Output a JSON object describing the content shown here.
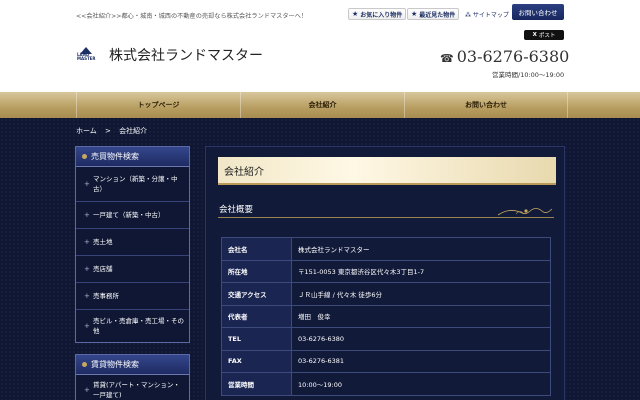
{
  "header": {
    "tagline": "<<会社紹介>>都心・城南・城西の不動産の売却なら株式会社ランドマスターへ！",
    "favorites_label": "お気に入り物件",
    "recent_label": "最近見た物件",
    "sitemap_label": "サイトマップ",
    "contact_label": "お問い合わせ",
    "x_post_label": "ポスト",
    "logo_text_1": "LAND",
    "logo_text_2": "MASTER",
    "company_name": "株式会社ランドマスター",
    "phone": "03-6276-6380",
    "hours": "営業時間/10:00～19:00"
  },
  "nav": {
    "items": [
      {
        "label": "トップページ"
      },
      {
        "label": "会社紹介"
      },
      {
        "label": "お問い合わせ"
      }
    ]
  },
  "breadcrumb": {
    "home": "ホーム",
    "separator": ">",
    "current": "会社紹介"
  },
  "sidebar": {
    "sale_title": "売買物件検索",
    "sale_items": [
      {
        "label": "マンション（新築・分譲・中古）"
      },
      {
        "label": "一戸建て（新築・中古）"
      },
      {
        "label": "売土地"
      },
      {
        "label": "売店舗"
      },
      {
        "label": "売事務所"
      },
      {
        "label": "売ビル・売倉庫・売工場・その他"
      }
    ],
    "rent_title": "賃貸物件検索",
    "rent_items": [
      {
        "label": "賃貸(アパート・マンション・一戸建て)"
      }
    ]
  },
  "main": {
    "title": "会社紹介",
    "section_title": "会社概要",
    "rows": [
      {
        "key": "会社名",
        "value": "株式会社ランドマスター"
      },
      {
        "key": "所在地",
        "value": "〒151-0053 東京都渋谷区代々木3丁目1-7"
      },
      {
        "key": "交通アクセス",
        "value": "ＪＲ山手線 / 代々木 徒歩6分"
      },
      {
        "key": "代表者",
        "value": "増田　俊幸"
      },
      {
        "key": "TEL",
        "value": "03-6276-6380"
      },
      {
        "key": "FAX",
        "value": "03-6276-6381"
      },
      {
        "key": "営業時間",
        "value": "10:00～19:00"
      }
    ]
  },
  "colors": {
    "navy": "#0f1734",
    "gold": "#b89e61",
    "brand_blue": "#1e2f64"
  }
}
